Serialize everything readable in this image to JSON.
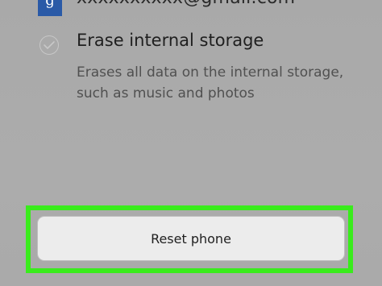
{
  "account": {
    "avatar_letter": "g",
    "email": "xxxxxxxxxx@gmail.com"
  },
  "erase_option": {
    "title": "Erase internal storage",
    "description": "Erases all data on the internal storage, such as music and photos",
    "checked": false
  },
  "reset_button": {
    "label": "Reset phone"
  },
  "colors": {
    "highlight": "#39ec1c",
    "avatar": "#2a5aa7",
    "background": "#aaaaaa"
  }
}
